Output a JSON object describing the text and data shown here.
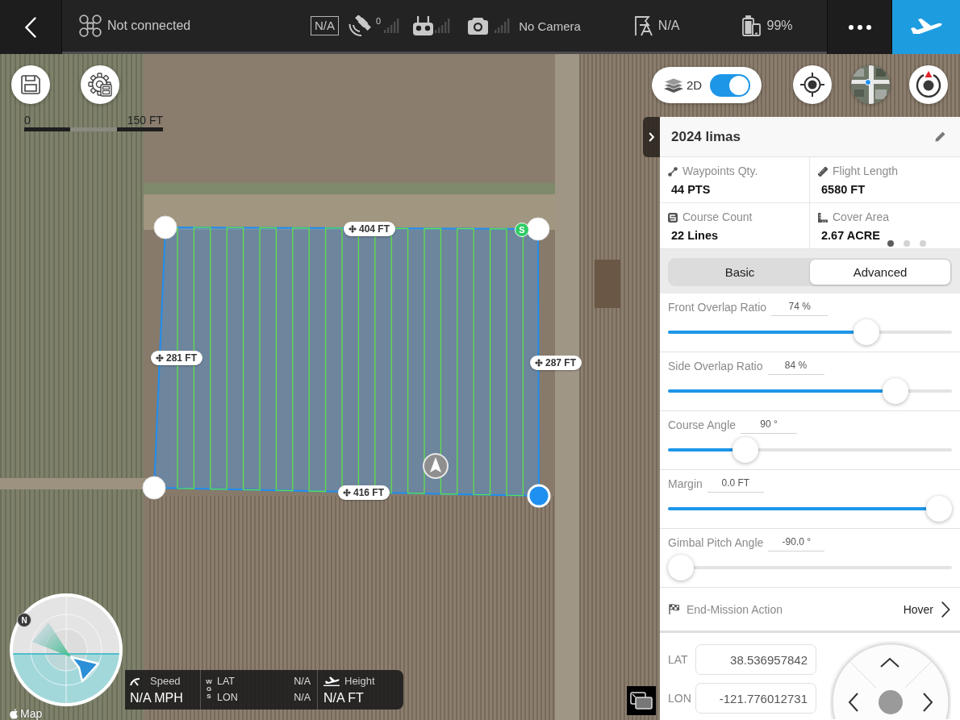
{
  "top_bar": {
    "connection": "Not connected",
    "status_box": "N/A",
    "satellite_count": "0",
    "camera": "No Camera",
    "flight_mode": "N/A",
    "battery": "99%"
  },
  "map": {
    "scale": {
      "start": "0",
      "end": "150 FT"
    },
    "view_toggle": {
      "label": "2D",
      "on": true
    },
    "mission": {
      "edge_labels": [
        "404 FT",
        "281 FT",
        "287 FT",
        "416 FT"
      ],
      "start_marker": "S",
      "vertices": [
        {
          "selected": false
        },
        {
          "selected": false
        },
        {
          "selected": true
        },
        {
          "selected": false
        }
      ]
    },
    "radar": {
      "north": "N"
    },
    "telemetry": {
      "speed_label": "Speed",
      "speed": "N/A MPH",
      "datum": "WGS",
      "lat_label": "LAT",
      "lat": "N/A",
      "lon_label": "LON",
      "lon": "N/A",
      "height_label": "Height",
      "height": "N/A FT"
    },
    "attribution": "Map"
  },
  "panel": {
    "title": "2024 limas",
    "stats": [
      {
        "kind": "waypoints",
        "label": "Waypoints Qty.",
        "value": "44 PTS"
      },
      {
        "kind": "length",
        "label": "Flight Length",
        "value": "6580 FT"
      },
      {
        "kind": "courses",
        "label": "Course Count",
        "value": "22 Lines"
      },
      {
        "kind": "area",
        "label": "Cover Area",
        "value": "2.67 ACRE"
      }
    ],
    "stat_pages": [
      {
        "selected": true
      },
      {
        "selected": false
      },
      {
        "selected": false
      }
    ],
    "tabs": [
      {
        "label": "Basic",
        "selected": false
      },
      {
        "label": "Advanced",
        "selected": true
      }
    ],
    "settings": [
      {
        "label": "Front Overlap Ratio",
        "reading": "74 %",
        "level": 0.72
      },
      {
        "label": "Side Overlap Ratio",
        "reading": "84 %",
        "level": 0.83
      },
      {
        "label": "Course Angle",
        "reading": "90 °",
        "level": 0.25
      },
      {
        "label": "Margin",
        "reading": "0.0 FT",
        "level": 1
      },
      {
        "label": "Gimbal Pitch Angle",
        "reading": "-90.0 °",
        "level": 0
      }
    ],
    "end_action": {
      "label": "End-Mission Action",
      "value": "Hover"
    },
    "coordinates": [
      {
        "label": "LAT",
        "value": "38.536957842"
      },
      {
        "label": "LON",
        "value": "-121.776012731"
      }
    ]
  }
}
